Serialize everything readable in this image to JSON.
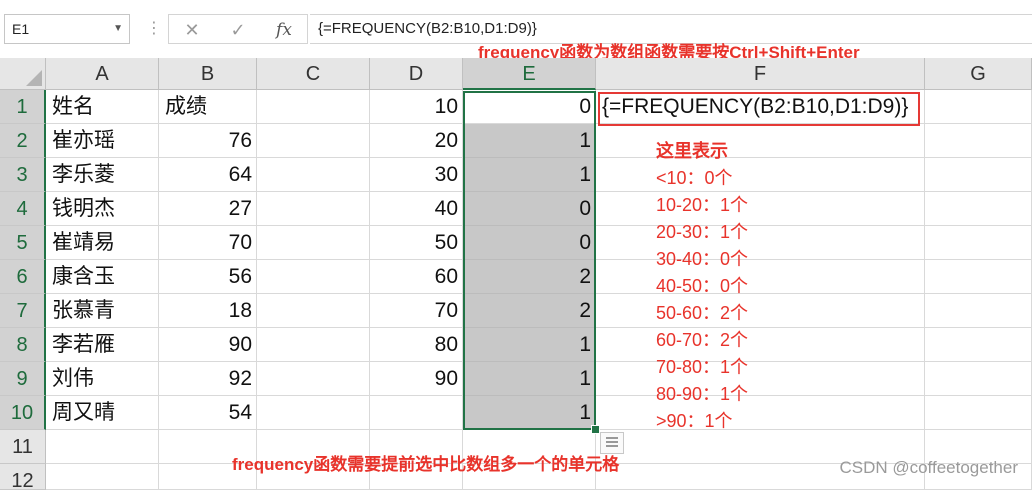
{
  "formula_bar": {
    "name_box": "E1",
    "cancel_icon": "✕",
    "enter_icon": "✓",
    "fx_label": "fx",
    "formula": "{=FREQUENCY(B2:B10,D1:D9)}"
  },
  "annotations": {
    "top_note": "frequency函数为数组函数需要按Ctrl+Shift+Enter",
    "bottom_note": "frequency函数需要提前选中比数组多一个的单元格",
    "explain_title": "这里表示",
    "explain_lines": [
      "<10：0个",
      "10-20：1个",
      "20-30：1个",
      "30-40：0个",
      "40-50：0个",
      "50-60：2个",
      "60-70：2个",
      "70-80：1个",
      "80-90：1个",
      ">90：1个"
    ],
    "watermark": "CSDN @coffeetogether",
    "accent_color": "#e8332b"
  },
  "sheet": {
    "columns": [
      "A",
      "B",
      "C",
      "D",
      "E",
      "F",
      "G"
    ],
    "row_numbers": [
      "1",
      "2",
      "3",
      "4",
      "5",
      "6",
      "7",
      "8",
      "9",
      "10",
      "11",
      "12"
    ],
    "col_a": [
      "姓名",
      "崔亦瑶",
      "李乐菱",
      "钱明杰",
      "崔靖易",
      "康含玉",
      "张慕青",
      "李若雁",
      "刘伟",
      "周又晴"
    ],
    "col_b": [
      "成绩",
      "76",
      "64",
      "27",
      "70",
      "56",
      "18",
      "90",
      "92",
      "54"
    ],
    "col_d": [
      "10",
      "20",
      "30",
      "40",
      "50",
      "60",
      "70",
      "80",
      "90"
    ],
    "col_e": [
      "0",
      "1",
      "1",
      "0",
      "0",
      "2",
      "2",
      "1",
      "1",
      "1"
    ],
    "f1": "{=FREQUENCY(B2:B10,D1:D9)}",
    "selected_cell": "E1",
    "selected_range": "E1:E10",
    "selection_color": "#217346"
  }
}
